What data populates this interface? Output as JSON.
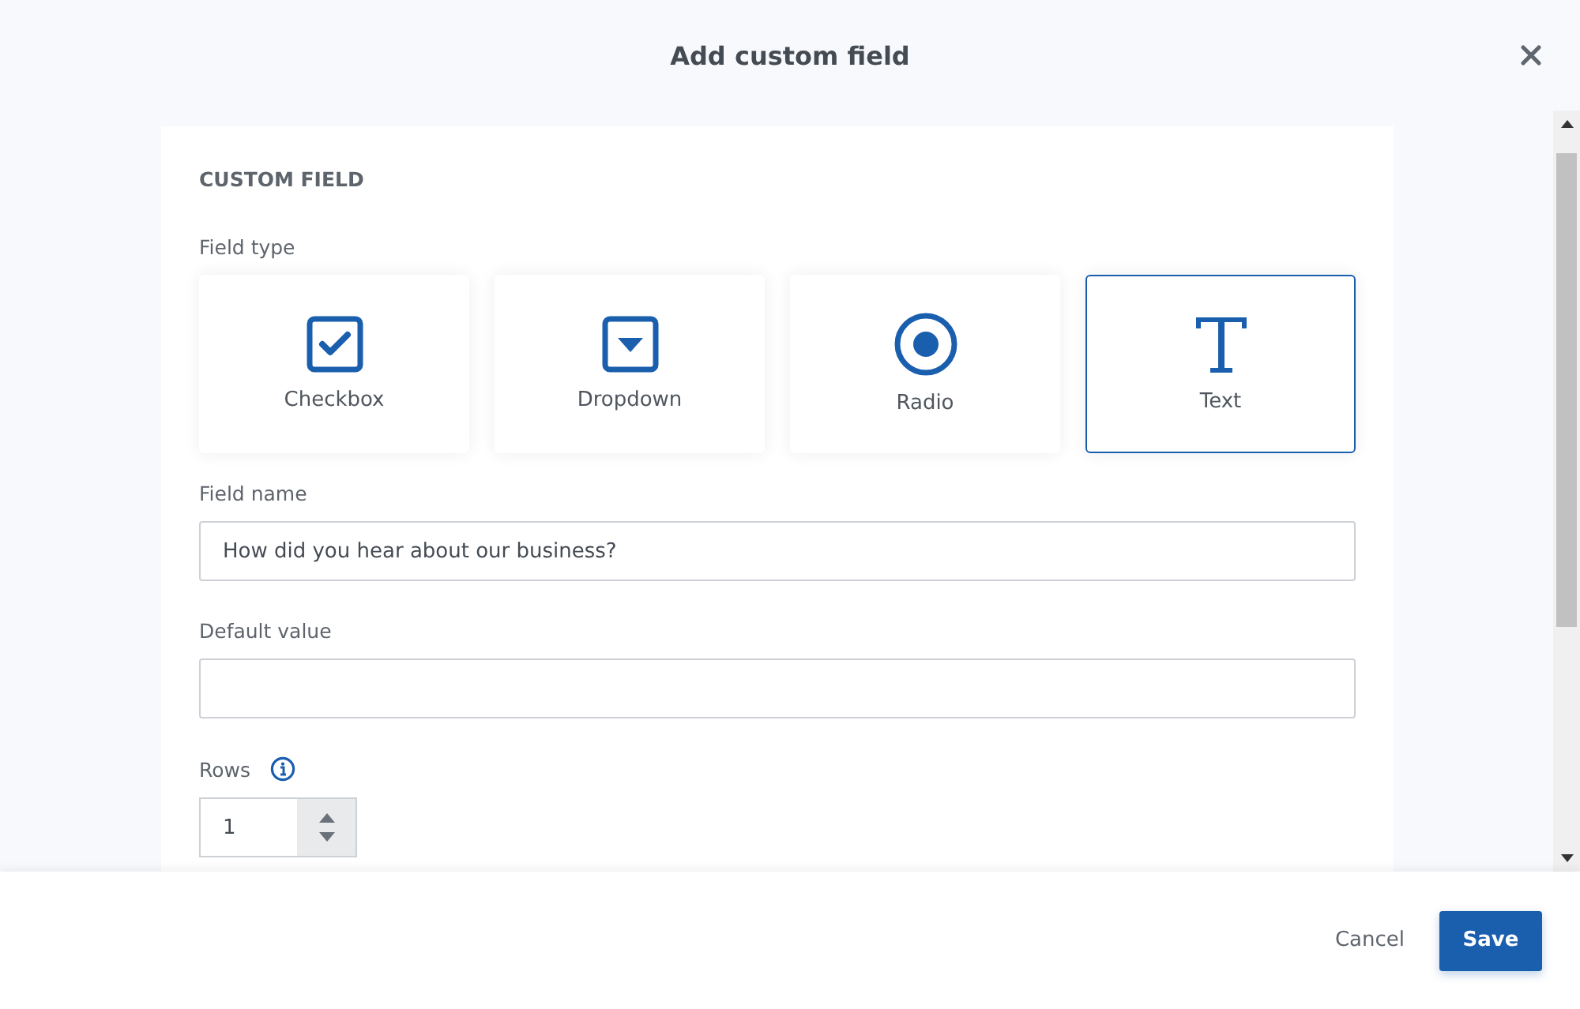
{
  "dialog": {
    "title": "Add custom field"
  },
  "section": {
    "heading": "CUSTOM FIELD"
  },
  "field_type": {
    "label": "Field type",
    "options": [
      {
        "kind": "checkbox",
        "label": "Checkbox",
        "selected": false
      },
      {
        "kind": "dropdown",
        "label": "Dropdown",
        "selected": false
      },
      {
        "kind": "radio",
        "label": "Radio",
        "selected": false
      },
      {
        "kind": "text",
        "label": "Text",
        "selected": true
      }
    ]
  },
  "field_name": {
    "label": "Field name",
    "value": "How did you hear about our business?"
  },
  "default_value": {
    "label": "Default value"
  },
  "rows": {
    "label": "Rows",
    "value": "1"
  },
  "buttons": {
    "cancel": "Cancel",
    "save": "Save"
  }
}
